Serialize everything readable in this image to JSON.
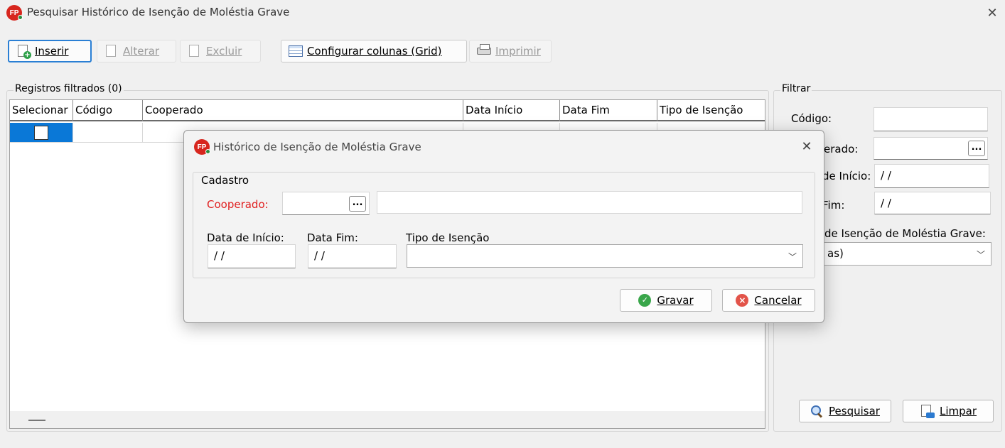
{
  "window": {
    "title": "Pesquisar Histórico de Isenção de Moléstia Grave",
    "logo_text": "FP"
  },
  "toolbar": {
    "inserir": "Inserir",
    "alterar": "Alterar",
    "excluir": "Excluir",
    "configurar": "Configurar colunas (Grid)",
    "imprimir": "Imprimir"
  },
  "grid": {
    "group_label": "Registros filtrados (0)",
    "columns": [
      "Selecionar",
      "Código",
      "Cooperado",
      "Data Início",
      "Data Fim",
      "Tipo de Isenção"
    ]
  },
  "filter": {
    "group_label": "Filtrar",
    "codigo_label": "Código:",
    "cooperado_label": "erado:",
    "data_inicio_label": "de Início:",
    "data_inicio_value": "/ /",
    "data_fim_label": "Fim:",
    "data_fim_value": "/ /",
    "tipo_label": "de Isenção de Moléstia Grave:",
    "tipo_value": "as)",
    "pesquisar": "Pesquisar",
    "limpar": "Limpar",
    "ellipsis": "..."
  },
  "modal": {
    "title": "Histórico de Isenção de Moléstia Grave",
    "group_label": "Cadastro",
    "cooperado_label": "Cooperado:",
    "data_inicio_label": "Data de Início:",
    "data_inicio_value": "/ /",
    "data_fim_label": "Data Fim:",
    "data_fim_value": "/ /",
    "tipo_label": "Tipo de Isenção",
    "gravar": "Gravar",
    "cancelar": "Cancelar",
    "ellipsis": "..."
  },
  "colors": {
    "accent": "#2a7fd4",
    "selection": "#0a78d7",
    "required": "#e02020"
  }
}
